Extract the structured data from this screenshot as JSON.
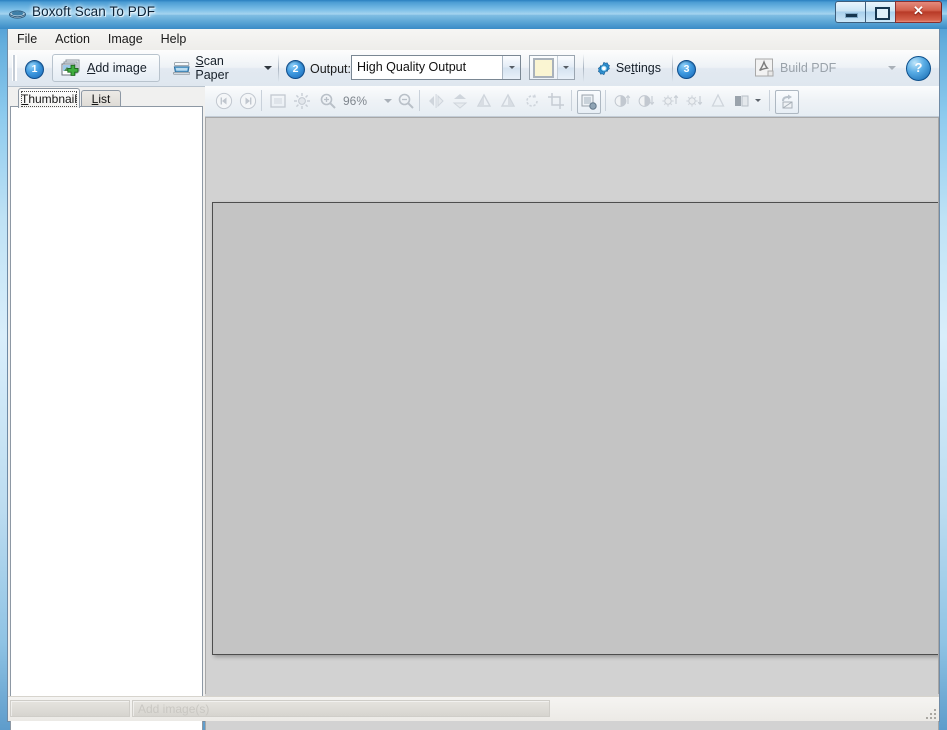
{
  "window": {
    "title": "Boxoft Scan To PDF",
    "icon": "scanner-icon",
    "controls": {
      "minimize": "minimize-icon",
      "maximize": "restore-icon",
      "close": "✕"
    }
  },
  "menubar": {
    "items": [
      {
        "label": "File",
        "name": "menu-file"
      },
      {
        "label": "Action",
        "name": "menu-action"
      },
      {
        "label": "Image",
        "name": "menu-image"
      },
      {
        "label": "Help",
        "name": "menu-help"
      }
    ]
  },
  "toolbar": {
    "step1_badge": "1",
    "add_image": {
      "label_pre": "A",
      "label_accel": "A",
      "label_rest": "dd image",
      "full": "Add image",
      "icon": "add-image-icon"
    },
    "scan_paper": {
      "full": "Scan Paper",
      "icon": "scanner-icon"
    },
    "step2_badge": "2",
    "output_label": "Output:",
    "output_value": "High Quality Output",
    "color_swatch": "#FAF5D2",
    "settings": {
      "full": "Settings",
      "icon": "gear-icon"
    },
    "step3_badge": "3",
    "build_pdf": {
      "full": "Build PDF",
      "icon": "pdf-icon",
      "disabled": true
    },
    "help": {
      "label": "?",
      "icon": "help-icon"
    }
  },
  "image_toolbar": {
    "zoom_level": "96%",
    "buttons": [
      "first-page-icon",
      "last-page-icon",
      "fit-page-icon",
      "fit-width-icon",
      "zoom-in-icon",
      "zoom-out-icon",
      "flip-horizontal-icon",
      "flip-vertical-icon",
      "rotate-left-icon",
      "rotate-right-icon",
      "rotate-free-icon",
      "crop-icon",
      "deskew-icon",
      "contrast-up-icon",
      "contrast-down-icon",
      "brightness-up-icon",
      "brightness-down-icon",
      "sharpen-icon",
      "color-mode-icon",
      "undo-icon"
    ]
  },
  "sidebar": {
    "tabs": [
      {
        "label": "Thumbnail",
        "name": "tab-thumbnail",
        "active": true
      },
      {
        "label": "List",
        "name": "tab-list",
        "active": false
      }
    ],
    "panel_empty": true
  },
  "statusbar": {
    "message": "Add image(s)"
  }
}
